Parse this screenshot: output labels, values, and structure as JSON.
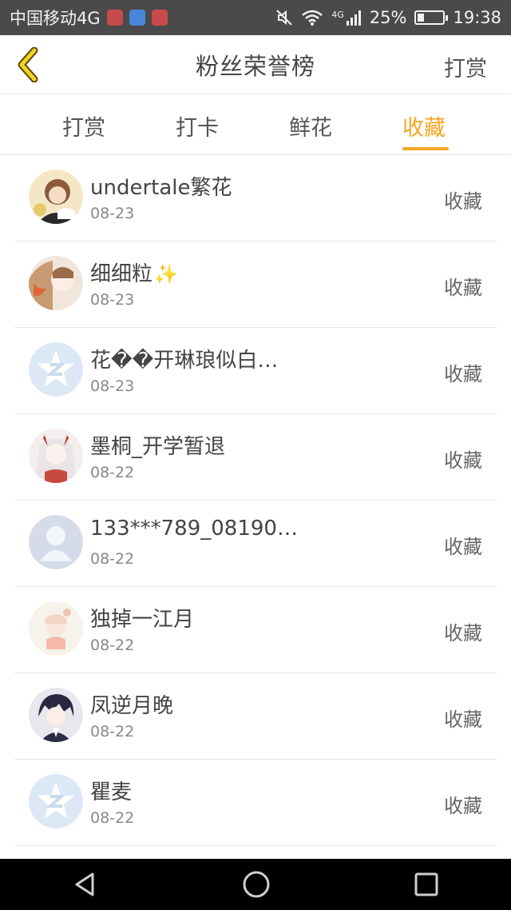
{
  "status_bar": {
    "carrier": "中国移动4G",
    "network_small": "4G",
    "battery_percent": "25%",
    "time": "19:38"
  },
  "header": {
    "title": "粉丝荣誉榜",
    "action_label": "打赏"
  },
  "tabs": [
    {
      "label": "打赏"
    },
    {
      "label": "打卡"
    },
    {
      "label": "鲜花"
    },
    {
      "label": "收藏"
    }
  ],
  "active_tab": "收藏",
  "colors": {
    "accent": "#f5a623"
  },
  "fans": [
    {
      "name": "undertale繁花",
      "date": "08-23",
      "action": "收藏",
      "avatar": "photo-avatar-bear"
    },
    {
      "name": "细细粒",
      "date": "08-23",
      "action": "收藏",
      "avatar": "photo-avatar-fox",
      "sparkle": "✨"
    },
    {
      "name": "花��开琳琅似白…",
      "date": "08-23",
      "action": "收藏",
      "avatar": "default-star-avatar"
    },
    {
      "name": "墨桐_开学暂退",
      "date": "08-22",
      "action": "收藏",
      "avatar": "photo-avatar-anime-girl"
    },
    {
      "name": "133***789_08190…",
      "date": "08-22",
      "action": "收藏",
      "avatar": "default-person-avatar"
    },
    {
      "name": "独掉一江月",
      "date": "08-22",
      "action": "收藏",
      "avatar": "photo-avatar-chibi"
    },
    {
      "name": "凤逆月晚",
      "date": "08-22",
      "action": "收藏",
      "avatar": "photo-avatar-anime-boy"
    },
    {
      "name": "瞿麦",
      "date": "08-22",
      "action": "收藏",
      "avatar": "default-star-avatar"
    }
  ]
}
